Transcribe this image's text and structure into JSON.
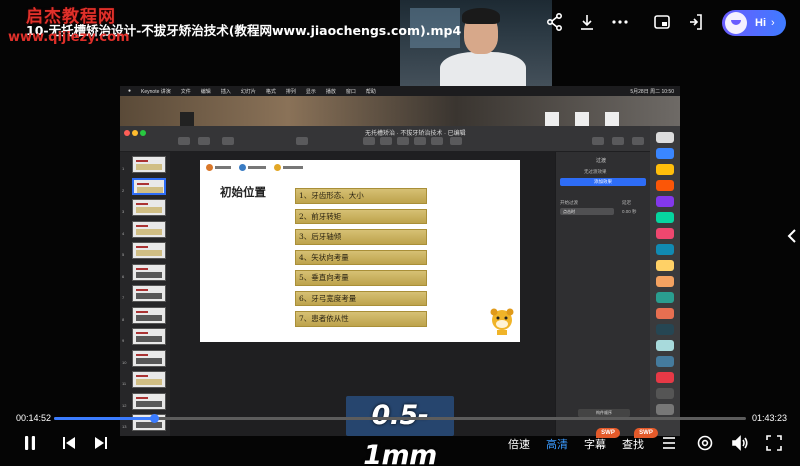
{
  "watermark": {
    "site_name": "启杰教程网",
    "site_url": "www.qijiezy.com"
  },
  "video": {
    "title": "10-无托槽矫治设计-不拔牙矫治技术(教程网www.jiaochengs.com).mp4",
    "current_time": "00:14:52",
    "total_time": "01:43:23",
    "progress": 0.1438,
    "overlay_subtitle": "0.5-1mm"
  },
  "top_controls": {
    "icons": [
      "share-icon",
      "download-icon",
      "more-icon",
      "picture-in-picture-icon",
      "mini-window-icon"
    ],
    "assistant_label": "Hi",
    "assistant_chevron": "›"
  },
  "keynote": {
    "menu": [
      "Keynote 讲演",
      "文件",
      "编辑",
      "插入",
      "幻灯片",
      "格式",
      "排列",
      "显示",
      "播放",
      "窗口",
      "帮助"
    ],
    "clock": "5月28日 周二 10:50",
    "doc_title": "无托槽矫治 · 不拔牙矫治技术 · 已编辑",
    "slide": {
      "heading": "初始位置",
      "items": [
        "1、牙齿形态、大小",
        "2、前牙转矩",
        "3、后牙轴倾",
        "4、矢状向考量",
        "5、垂直向考量",
        "6、牙弓宽度考量",
        "7、患者依从性"
      ]
    },
    "inspector": {
      "tab": "过渡",
      "section": "无过渡效果",
      "add_button": "添加效果",
      "start_label": "开始过渡",
      "start_value": "点击时",
      "delay_label": "延迟",
      "delay_value": "0.00 秒",
      "bottom_button": "构件顺序"
    },
    "thumb_count": 13
  },
  "bottom_controls": {
    "speed_label": "倍速",
    "quality_label": "高清",
    "subtitle_label": "字幕",
    "search_label": "查找",
    "swp_badge": "SWP",
    "swp_badge_2": "SWP"
  },
  "colors": {
    "accent_blue": "#3b7cff",
    "watermark_red": "#e0302a",
    "slide_bar_gold": "#c9b15e",
    "subtitle_bg": "#26456e"
  }
}
